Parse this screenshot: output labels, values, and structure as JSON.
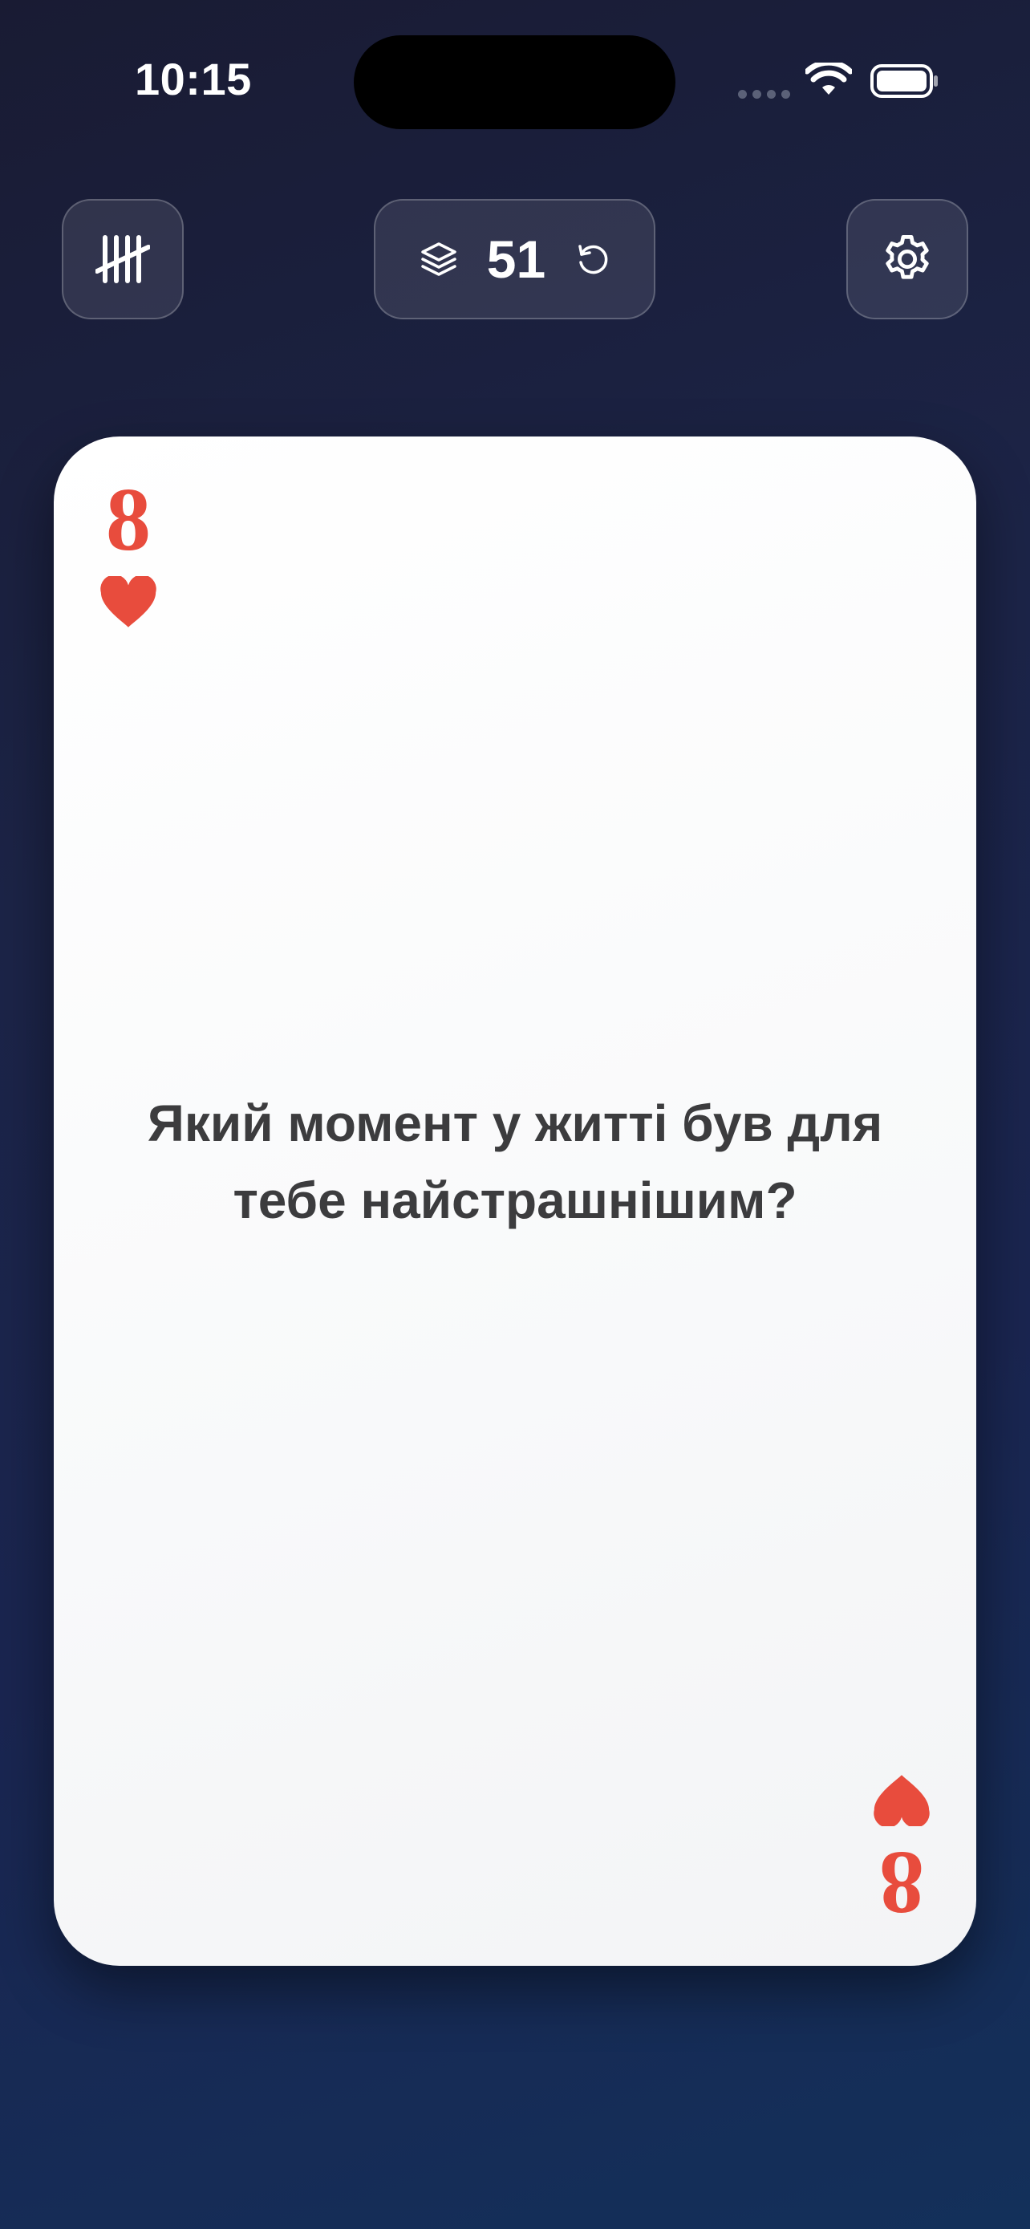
{
  "status_bar": {
    "time": "10:15"
  },
  "toolbar": {
    "tally_icon": "tally-marks-icon",
    "deck_icon": "layers-stack-icon",
    "deck_count": "51",
    "reset_icon": "rotate-ccw-icon",
    "settings_icon": "gear-icon"
  },
  "card": {
    "rank": "8",
    "suit": "hearts",
    "suit_color": "#e84c3d",
    "question": "Який момент у житті був для тебе найстрашнішим?"
  },
  "colors": {
    "background_top": "#191b33",
    "background_bottom": "#13305a",
    "card": "#ffffff",
    "text": "#3c3c3e"
  }
}
